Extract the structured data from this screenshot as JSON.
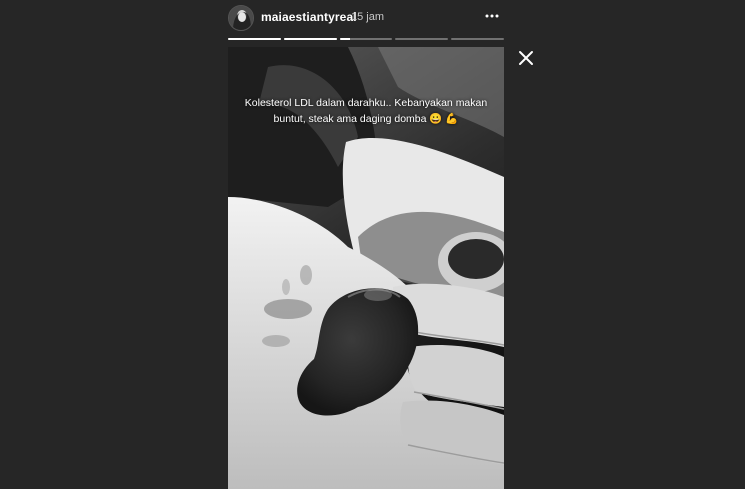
{
  "story": {
    "username": "maiaestiantyreal",
    "timestamp": "15 jam",
    "caption": "Kolesterol LDL dalam darahku.. Kebanyakan makan buntut, steak ama daging domba 😀 💪",
    "progress": [
      1,
      1,
      0.2,
      0,
      0
    ]
  },
  "icons": {
    "more": "more-horizontal-icon",
    "close": "close-icon"
  },
  "colors": {
    "background": "#262626",
    "text": "#ffffff",
    "timestamp": "#c8c8c8"
  }
}
